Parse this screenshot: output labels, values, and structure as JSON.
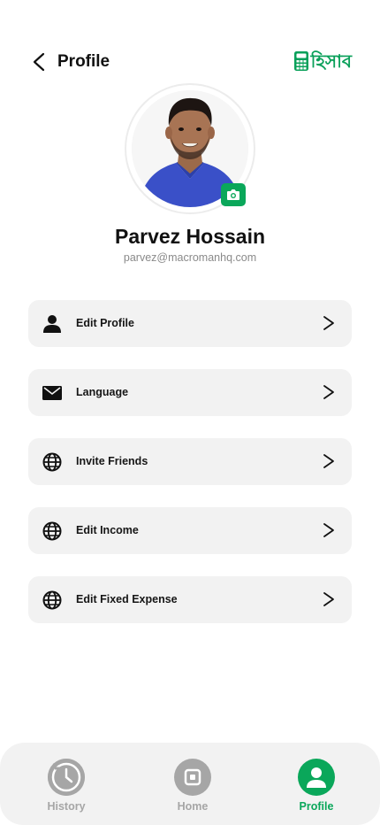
{
  "header": {
    "title": "Profile",
    "logo_text": "হিসাব"
  },
  "user": {
    "name": "Parvez Hossain",
    "email": "parvez@macromanhq.com"
  },
  "menu": [
    {
      "label": "Edit Profile",
      "icon": "person-icon"
    },
    {
      "label": "Language",
      "icon": "envelope-icon"
    },
    {
      "label": "Invite Friends",
      "icon": "globe-icon"
    },
    {
      "label": "Edit Income",
      "icon": "globe-icon"
    },
    {
      "label": "Edit Fixed Expense",
      "icon": "globe-icon"
    }
  ],
  "tabs": [
    {
      "label": "History",
      "icon": "clock-icon",
      "active": false
    },
    {
      "label": "Home",
      "icon": "home-icon",
      "active": false
    },
    {
      "label": "Profile",
      "icon": "profile-icon",
      "active": true
    }
  ],
  "colors": {
    "accent": "#0aa75a",
    "inactive": "#a6a6a6",
    "card_bg": "#f2f2f2"
  }
}
